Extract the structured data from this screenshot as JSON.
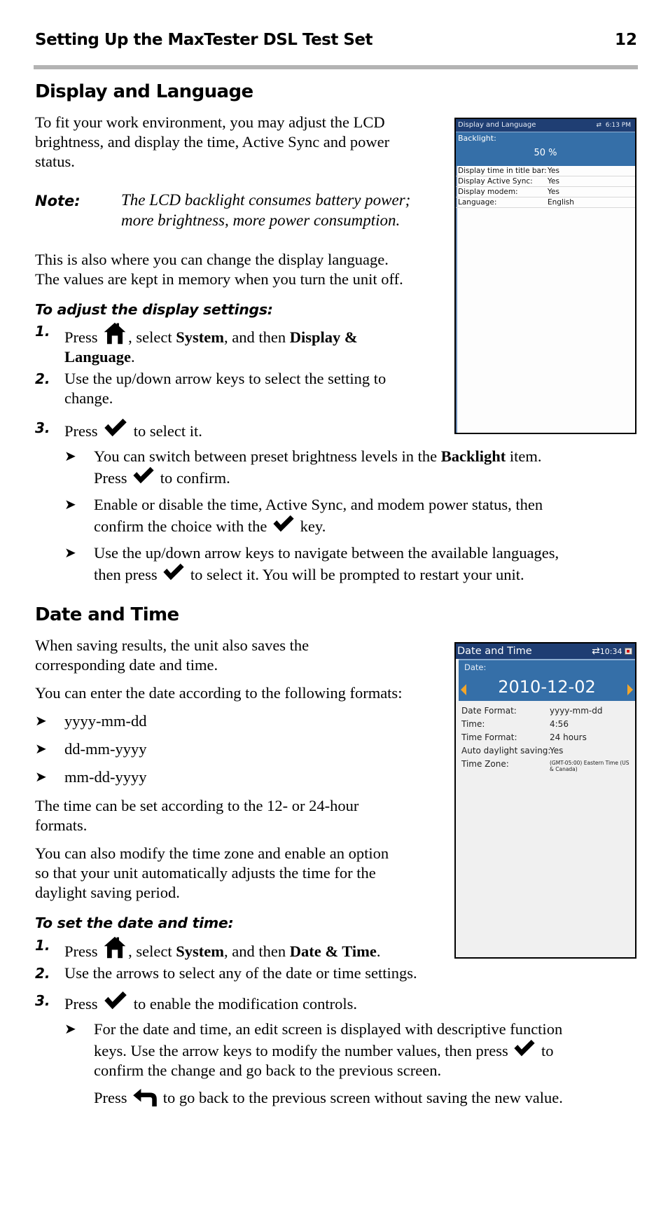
{
  "header": {
    "title": "Setting Up the MaxTester DSL Test Set",
    "page_number": "12"
  },
  "display_section": {
    "heading": "Display and Language",
    "intro": "To fit your work environment, you may adjust the LCD brightness, and display the time, Active Sync and power status.",
    "intro_lines": [
      "To fit your work environment, you may adjust the LCD",
      "brightness, and display the time, Active Sync and power",
      "status."
    ],
    "note_label": "Note:",
    "note_lines": [
      "The LCD backlight consumes battery power;",
      "more brightness, more power consumption."
    ],
    "para2_lines": [
      "This is also where you can change the display language.",
      "The values are kept in memory when you turn the unit off."
    ],
    "procedure_title": "To adjust the display settings:",
    "steps": [
      {
        "num": "1.",
        "pre": "Press",
        "icon": "home-icon",
        "mid": ", select ",
        "b1": "System",
        "mid2": ", and then ",
        "b2": "Display &",
        "line2_bold": "Language",
        "line2_end": "."
      },
      {
        "num": "2.",
        "lines": [
          "Use the up/down arrow keys to select the setting to",
          "change."
        ]
      },
      {
        "num": "3.",
        "pre": "Press",
        "icon": "checkmark-icon",
        "post": "to select it."
      }
    ],
    "bullets": [
      {
        "l1_pre": "You can switch between preset brightness levels in the ",
        "l1_bold": "Backlight",
        "l1_post": " item.",
        "l2_pre": "Press",
        "icon": "checkmark-icon",
        "l2_post": "to confirm."
      },
      {
        "l1": "Enable or disable the time, Active Sync, and modem power status, then",
        "l2_pre": "confirm the choice with the",
        "icon": "checkmark-icon",
        "l2_post": "key."
      },
      {
        "l1": "Use the up/down arrow keys to navigate between the available languages,",
        "l2_pre": "then press",
        "icon": "checkmark-icon",
        "l2_post": "to select it. You will be prompted to restart your unit."
      }
    ],
    "screen": {
      "title": "Display and Language",
      "sync_icon": "sync-arrows-icon",
      "time": "6:13 PM",
      "backlight_label": "Backlight:",
      "backlight_value": "50 %",
      "backlight_percent": 50,
      "rows": [
        {
          "label": "Display time in title bar:",
          "value": "Yes"
        },
        {
          "label": "Display Active Sync:",
          "value": "Yes"
        },
        {
          "label": "Display modem:",
          "value": "Yes"
        },
        {
          "label": "Language:",
          "value": "English"
        }
      ]
    }
  },
  "date_section": {
    "heading": "Date and Time",
    "intro_lines": [
      "When saving results, the unit also saves the",
      "corresponding date and time."
    ],
    "formats_intro": "You can enter the date according to the following formats:",
    "formats": [
      "yyyy-mm-dd",
      "dd-mm-yyyy",
      "mm-dd-yyyy"
    ],
    "time_para_lines": [
      "The time can be set according to the 12- or 24-hour",
      "formats."
    ],
    "zone_para_lines": [
      "You can also modify the time zone and enable an option",
      "so that your unit automatically adjusts the time for the",
      "daylight saving period."
    ],
    "procedure_title": "To set the date and time:",
    "steps": [
      {
        "num": "1.",
        "pre": "Press",
        "icon": "home-icon",
        "mid": ", select ",
        "b1": "System",
        "mid2": ", and then ",
        "b2": "Date & Time",
        "end": "."
      },
      {
        "num": "2.",
        "text": "Use the arrows to select any of the date or time settings."
      },
      {
        "num": "3.",
        "pre": "Press",
        "icon": "checkmark-icon",
        "post": "to enable the modification controls."
      }
    ],
    "bullet": {
      "l1": "For the date and time, an edit screen is displayed with descriptive function",
      "l2_pre": "keys. Use the arrow keys to modify the number values, then press",
      "icon": "checkmark-icon",
      "l2_post": "to",
      "l3": "confirm the change and go back to the previous screen.",
      "l4_pre": "Press",
      "back_icon": "back-arrow-icon",
      "l4_post": "to go back to the previous screen without saving the new value."
    },
    "screen": {
      "title": "Date and Time",
      "sync_icon": "sync-arrows-icon",
      "time": "10:34",
      "battery_icon": "battery-icon",
      "date_label": "Date:",
      "date_value": "2010-12-02",
      "rows": [
        {
          "label": "Date Format:",
          "value": "yyyy-mm-dd"
        },
        {
          "label": "Time:",
          "value": "4:56"
        },
        {
          "label": "Time Format:",
          "value": "24 hours"
        },
        {
          "label": "Auto daylight saving:",
          "value": "Yes"
        },
        {
          "label": "Time Zone:",
          "value": "(GMT-05:00) Eastern Time (US & Canada)"
        }
      ],
      "colors": {
        "title_bar": "#1f3e73",
        "selected_bg": "#356fa8",
        "arrow": "#f2a52a"
      }
    }
  }
}
